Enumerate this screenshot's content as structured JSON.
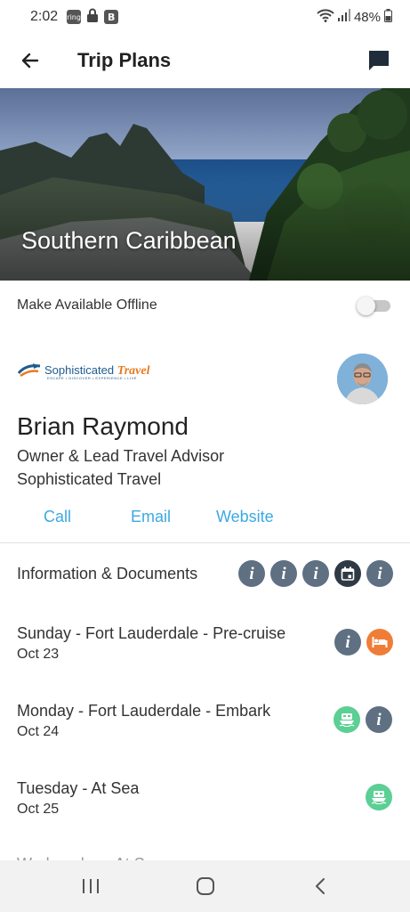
{
  "status_bar": {
    "time": "2:02",
    "icons": [
      "ring-icon",
      "lock-icon",
      "b-app-icon"
    ],
    "ring_label": "ring",
    "b_label": "B",
    "battery": "48%"
  },
  "app_bar": {
    "title": "Trip Plans"
  },
  "hero": {
    "title": "Southern Caribbean"
  },
  "offline": {
    "label": "Make Available Offline",
    "enabled": false
  },
  "advisor": {
    "brand_main": "Sophisticated",
    "brand_accent": "Travel",
    "brand_tagline": "ESCAPE • DISCOVER • EXPERIENCE • LIVE",
    "name": "Brian Raymond",
    "role": "Owner & Lead Travel Advisor",
    "company": "Sophisticated Travel",
    "actions": {
      "call": "Call",
      "email": "Email",
      "website": "Website"
    }
  },
  "sections": {
    "info_docs": {
      "label": "Information & Documents",
      "info_glyph": "i",
      "icons": [
        "info-icon",
        "info-icon",
        "info-icon",
        "calendar-icon",
        "info-icon"
      ]
    },
    "days": [
      {
        "title": "Sunday - Fort Lauderdale - Pre-cruise",
        "date": "Oct 23",
        "icons": [
          "info-icon",
          "hotel-icon"
        ]
      },
      {
        "title": "Monday - Fort Lauderdale - Embark",
        "date": "Oct 24",
        "icons": [
          "ship-icon",
          "info-icon"
        ]
      },
      {
        "title": "Tuesday - At Sea",
        "date": "Oct 25",
        "icons": [
          "ship-icon"
        ]
      }
    ],
    "cutoff": "Wednesday - At Sea"
  },
  "colors": {
    "accent_blue": "#3ca9e2",
    "info_grey": "#5e7081",
    "hotel_orange": "#f07d37",
    "ship_green": "#5ccf94"
  }
}
